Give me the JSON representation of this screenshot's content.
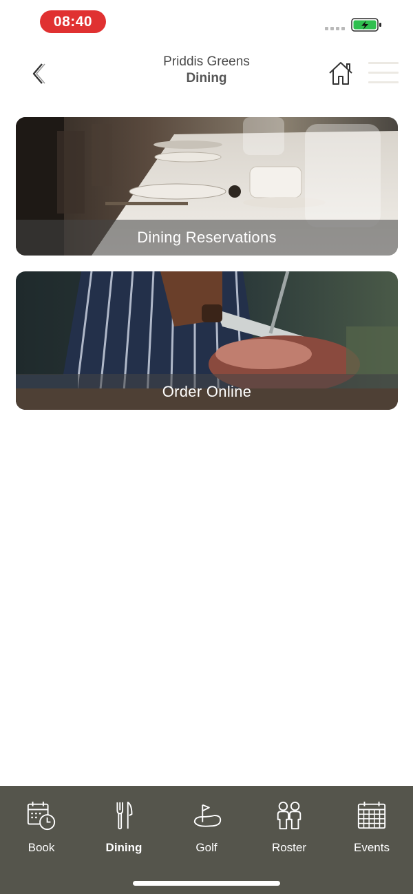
{
  "status_bar": {
    "time": "08:40",
    "time_pill_color": "#e03131",
    "battery_color": "#2fbf4f",
    "icons": [
      "signal-icon",
      "battery-charging-icon"
    ]
  },
  "header": {
    "club_name": "Priddis Greens",
    "title": "Dining",
    "icons": [
      "back-chevron-icon",
      "home-icon",
      "hamburger-menu-icon"
    ]
  },
  "cards": [
    {
      "label": "Dining Reservations",
      "image": "set-dining-table-photo"
    },
    {
      "label": "Order Online",
      "image": "chef-carving-meat-photo"
    }
  ],
  "tab_bar": {
    "background": "#55554c",
    "active": "Dining",
    "tabs": [
      {
        "label": "Book",
        "icon": "calendar-clock-icon"
      },
      {
        "label": "Dining",
        "icon": "fork-knife-icon"
      },
      {
        "label": "Golf",
        "icon": "golf-flag-icon"
      },
      {
        "label": "Roster",
        "icon": "people-icon"
      },
      {
        "label": "Events",
        "icon": "calendar-grid-icon"
      }
    ]
  }
}
